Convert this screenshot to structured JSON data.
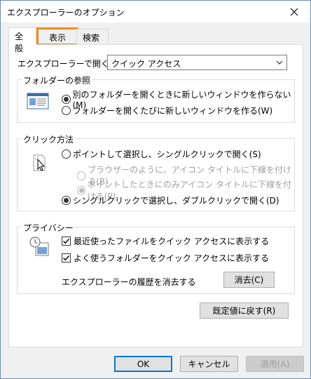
{
  "window": {
    "title": "エクスプローラーのオプション",
    "close_glyph": "✕"
  },
  "tabs": [
    {
      "label": "全般"
    },
    {
      "label": "表示"
    },
    {
      "label": "検索"
    }
  ],
  "open_in": {
    "label": "エクスプローラーで開く:",
    "value": "クイック アクセス"
  },
  "folder_browse": {
    "title": "フォルダーの参照",
    "options": [
      {
        "label": "別のフォルダーを開くときに新しいウィンドウを作らない(M)",
        "checked": true
      },
      {
        "label": "フォルダーを開くたびに新しいウィンドウを作る(W)",
        "checked": false
      }
    ]
  },
  "click_method": {
    "title": "クリック方法",
    "options": [
      {
        "label": "ポイントして選択し、シングルクリックで開く(S)",
        "checked": false
      },
      {
        "label": "ブラウザーのように、アイコン タイトルに下線を付ける(B)",
        "checked": false,
        "disabled": true
      },
      {
        "label": "ポイントしたときにのみアイコン タイトルに下線を付ける(P)",
        "checked": true,
        "disabled": true
      },
      {
        "label": "シングルクリックで選択し、ダブルクリックで開く(D)",
        "checked": true
      }
    ]
  },
  "privacy": {
    "title": "プライバシー",
    "checks": [
      {
        "label": "最近使ったファイルをクイック アクセスに表示する",
        "checked": true
      },
      {
        "label": "よく使うフォルダーをクイック アクセスに表示する",
        "checked": true
      }
    ],
    "clear_label": "エクスプローラーの履歴を消去する",
    "clear_button": "消去(C)"
  },
  "restore_button": "既定値に戻す(R)",
  "footer": {
    "ok": "OK",
    "cancel": "キャンセル",
    "apply": "適用(A)"
  },
  "colors": {
    "highlight": "#f08c1e",
    "default_button_border": "#0078d7"
  }
}
